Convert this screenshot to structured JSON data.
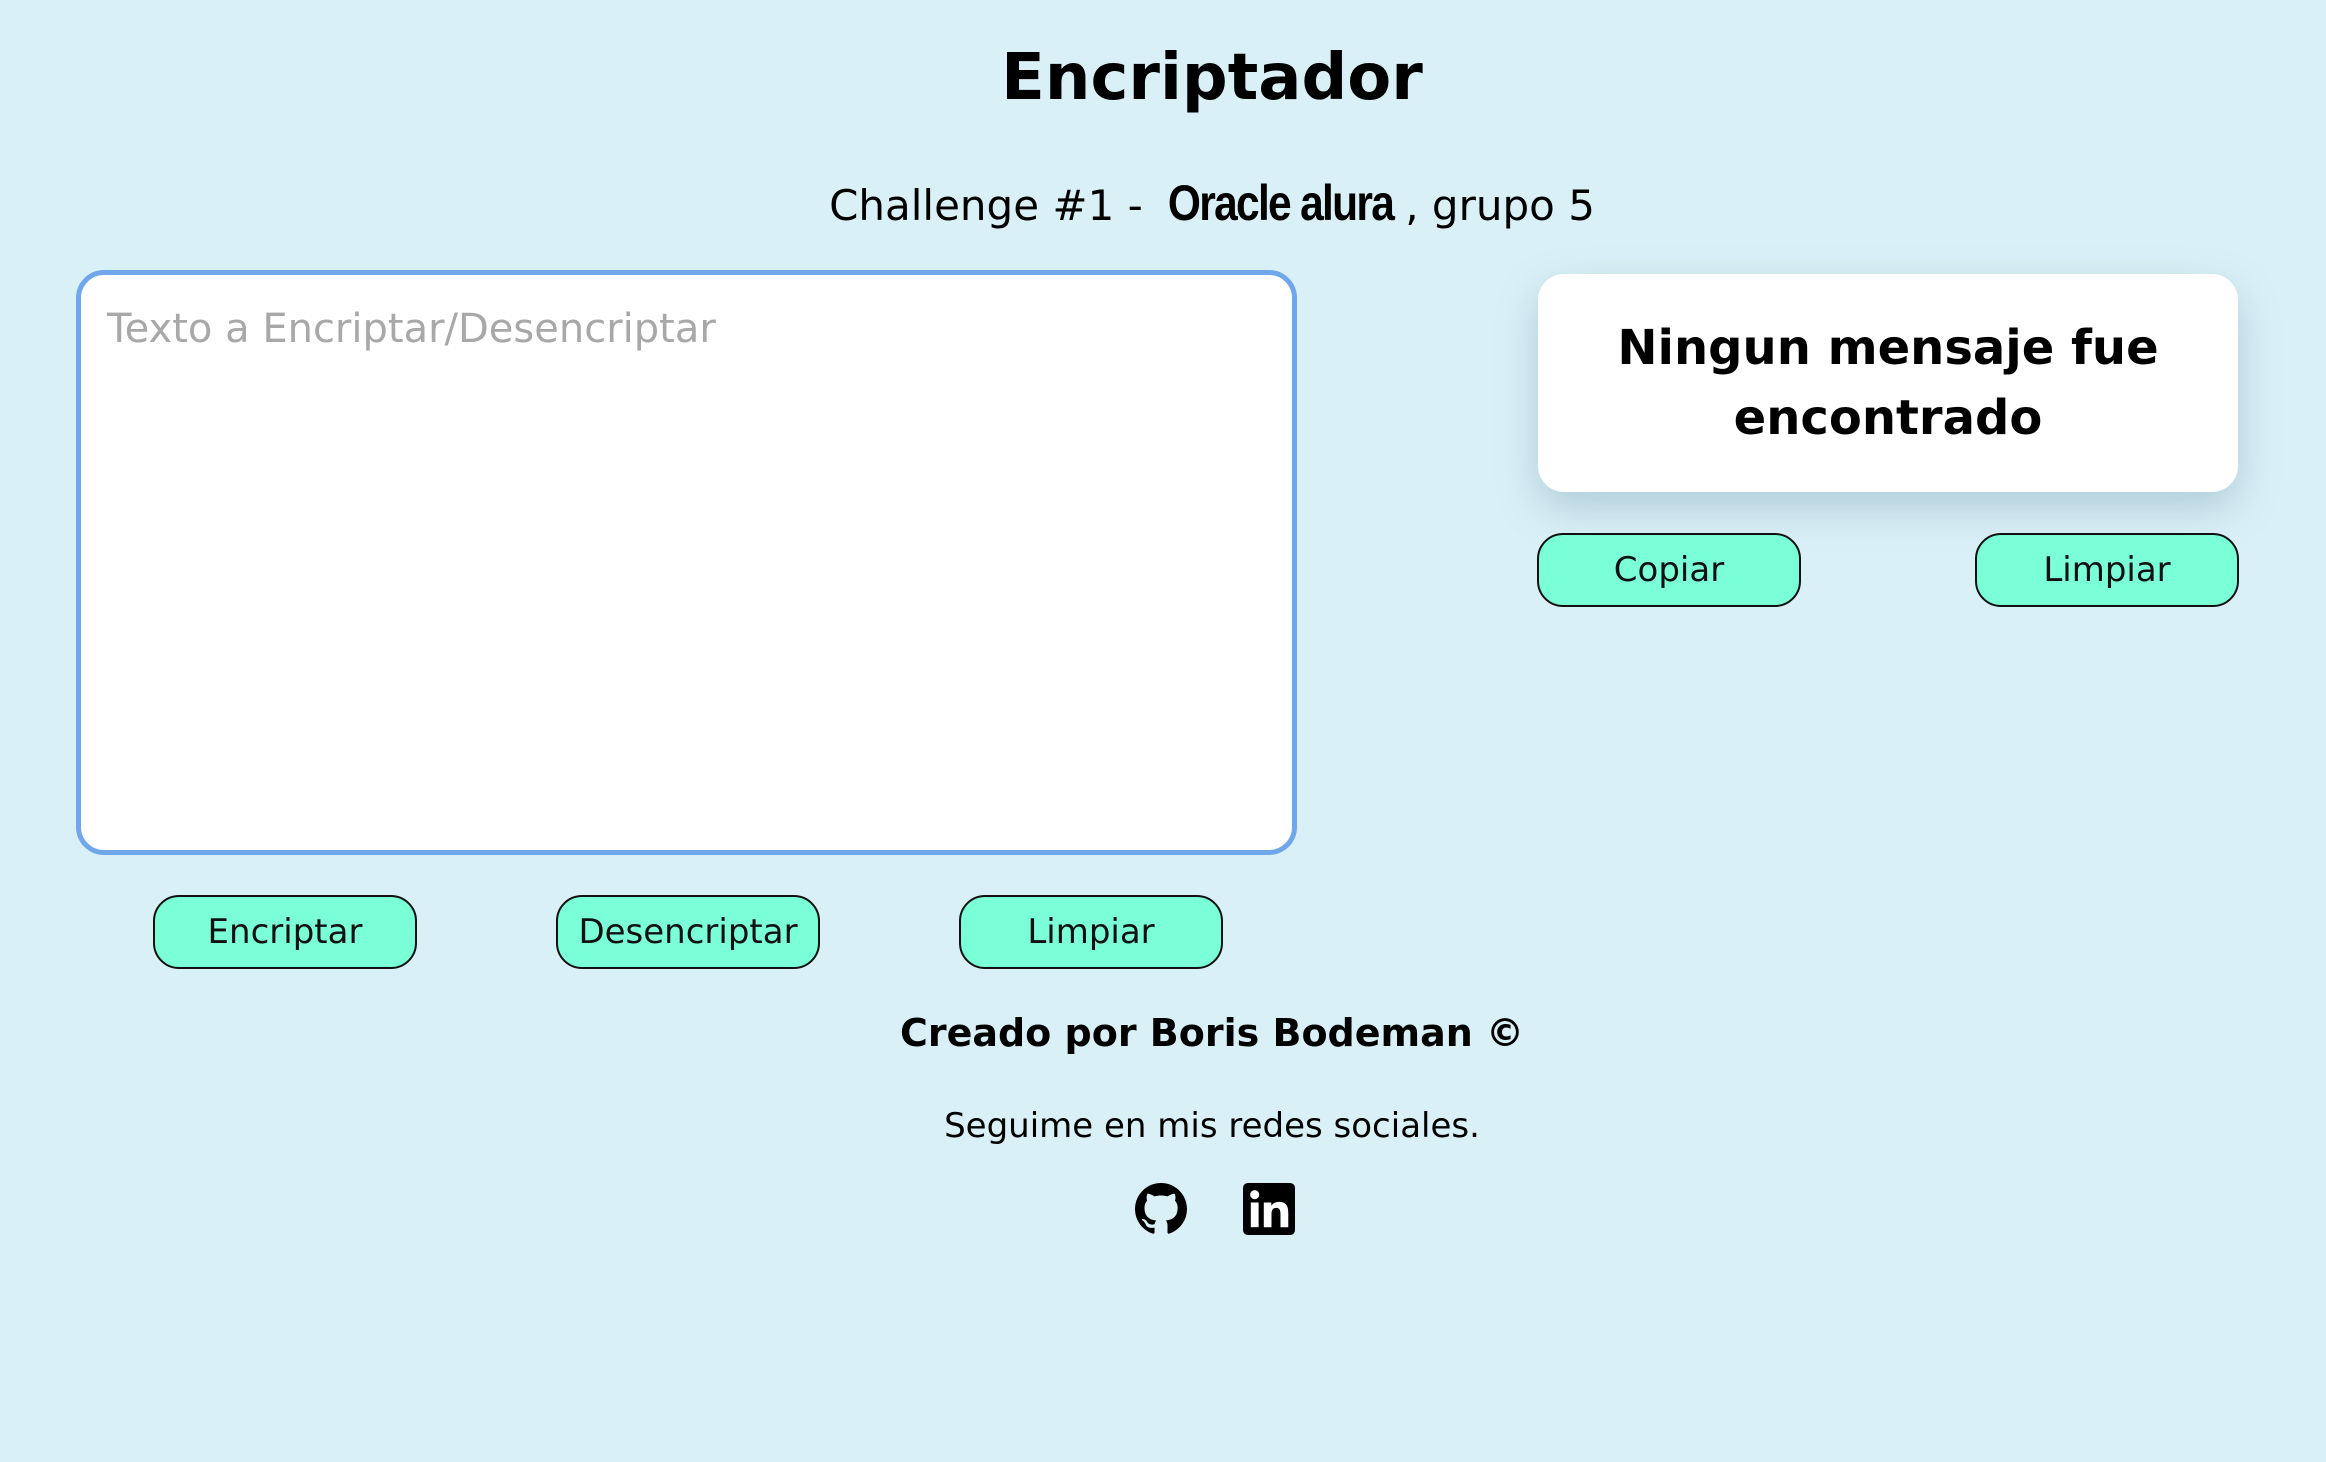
{
  "header": {
    "title": "Encriptador",
    "subtitle_prefix": "Challenge #1 - ",
    "subtitle_brand": "Oracle alura",
    "subtitle_suffix": ", grupo 5"
  },
  "input": {
    "placeholder": "Texto a Encriptar/Desencriptar",
    "value": ""
  },
  "actions": {
    "encrypt_label": "Encriptar",
    "decrypt_label": "Desencriptar",
    "clear_label": "Limpiar"
  },
  "output": {
    "message": "Ningun mensaje fue encontrado",
    "copy_label": "Copiar",
    "clear_label": "Limpiar"
  },
  "footer": {
    "credit": "Creado por Boris Bodeman ©",
    "follow": "Seguime en mis redes sociales.",
    "social": [
      {
        "name": "github-icon"
      },
      {
        "name": "linkedin-icon"
      }
    ]
  },
  "colors": {
    "background": "#daf0f7",
    "button": "#7affd6",
    "input_border": "#6fa7ea",
    "card": "#ffffff"
  }
}
